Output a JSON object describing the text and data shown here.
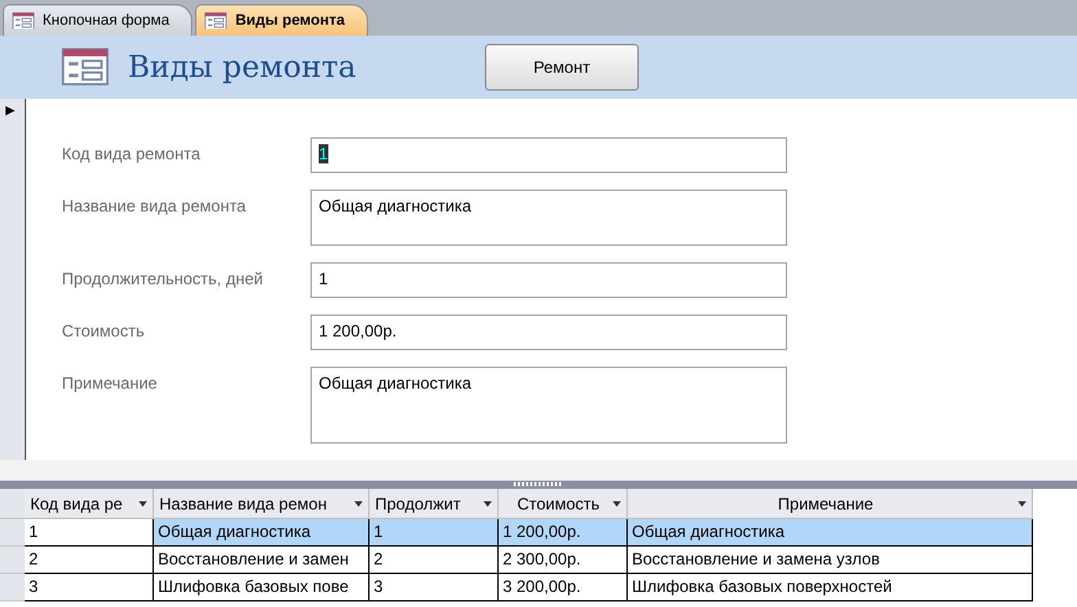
{
  "tabs": [
    {
      "label": "Кнопочная форма",
      "selected": false
    },
    {
      "label": "Виды ремонта",
      "selected": true
    }
  ],
  "form": {
    "title": "Виды ремонта",
    "button": "Ремонт",
    "current_record_marker": "▶",
    "fields": [
      {
        "label": "Код вида ремонта",
        "value": "1",
        "kind": "single",
        "focused": true
      },
      {
        "label": "Название вида ремонта",
        "value": "Общая диагностика",
        "kind": "multi",
        "focused": false
      },
      {
        "label": "Продолжительность, дней",
        "value": "1",
        "kind": "single",
        "focused": false
      },
      {
        "label": "Стоимость",
        "value": "1 200,00р.",
        "kind": "single",
        "focused": false
      },
      {
        "label": "Примечание",
        "value": "Общая диагностика",
        "kind": "tall",
        "focused": false
      }
    ]
  },
  "table": {
    "columns": [
      "Код вида ре",
      "Название вида ремон",
      "Продолжит",
      "Стоимость",
      "Примечание"
    ],
    "rows": [
      {
        "cells": [
          "1",
          "Общая диагностика",
          "1",
          "1 200,00р.",
          "Общая диагностика"
        ],
        "selected": true
      },
      {
        "cells": [
          "2",
          "Восстановление и замен",
          "2",
          "2 300,00р.",
          "Восстановление и замена узлов"
        ],
        "selected": false
      },
      {
        "cells": [
          "3",
          "Шлифовка базовых пове",
          "3",
          "3 200,00р.",
          "Шлифовка базовых поверхностей"
        ],
        "selected": false
      }
    ]
  }
}
